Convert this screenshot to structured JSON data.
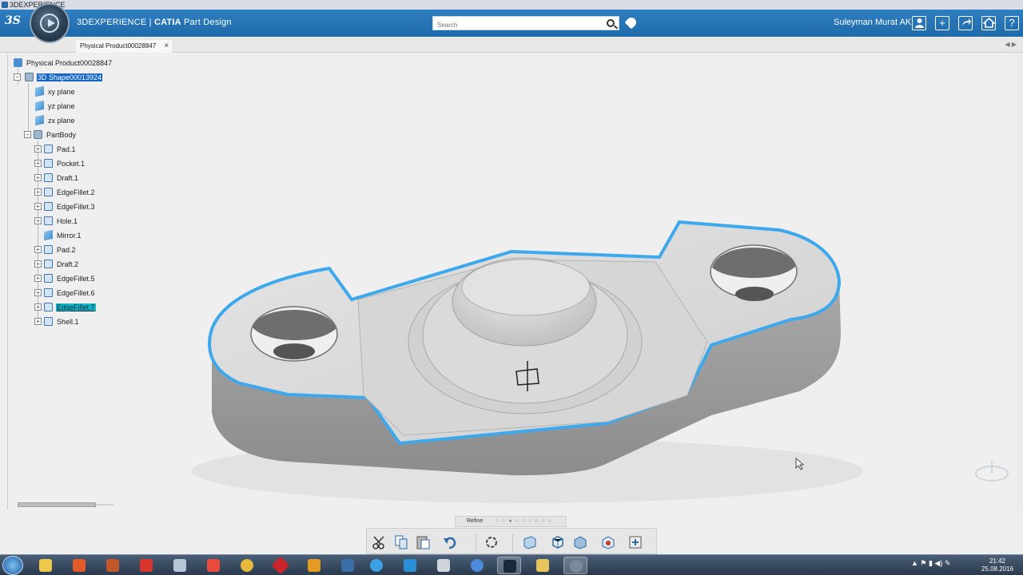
{
  "window": {
    "title": "3DEXPERIENCE"
  },
  "header": {
    "brand": "3DEXPERIENCE | ",
    "app": "CATIA",
    "module": " Part Design",
    "search_placeholder": "Search",
    "user": "Suleyman Murat AK"
  },
  "tab": {
    "label": "Physical Product00028847",
    "close": "×"
  },
  "tree": {
    "root": "Physical Product00028847",
    "shape": "3D Shape00013924",
    "planes": [
      "xy plane",
      "yz plane",
      "zx plane"
    ],
    "body": "PartBody",
    "features": [
      "Pad.1",
      "Pocket.1",
      "Draft.1",
      "EdgeFillet.2",
      "EdgeFillet.3",
      "Hole.1",
      "Mirror.1",
      "Pad.2",
      "Draft.2",
      "EdgeFillet.5",
      "EdgeFillet.6",
      "EdgeFillet.7",
      "Shell.1"
    ]
  },
  "refine": {
    "label": "Refine"
  },
  "taskbar": {
    "time": "21:42",
    "date": "25.08.2016"
  },
  "colors": {
    "header": "#1e6aab",
    "selection": "#1565c7",
    "highlight": "#13b5c6",
    "edge": "#34a9ea"
  }
}
